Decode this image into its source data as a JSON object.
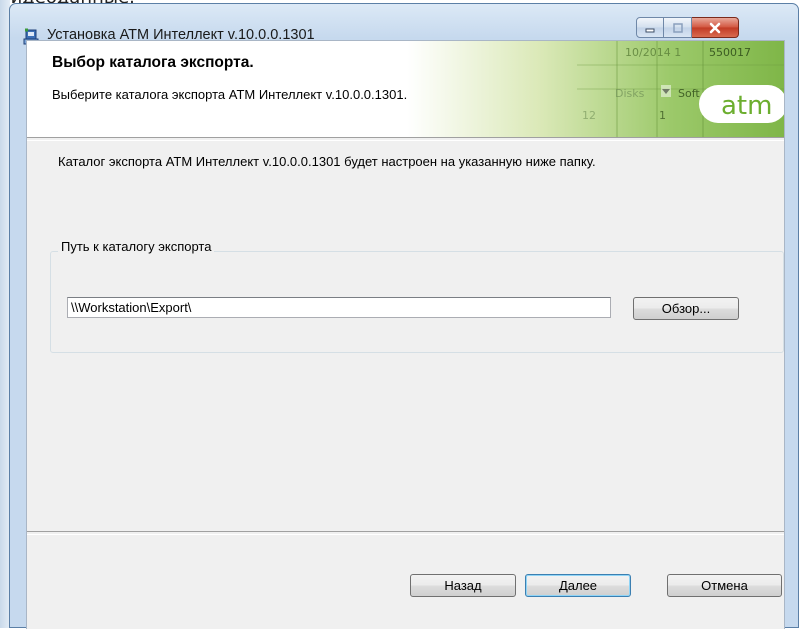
{
  "background_caption": "видеоданные.",
  "window": {
    "title": "Установка ATM Интеллект v.10.0.0.1301",
    "icon": "installer-icon",
    "caption_buttons": [
      "minimize-icon",
      "maximize-icon",
      "close-icon"
    ]
  },
  "banner": {
    "title": "Выбор каталога экспорта.",
    "subtitle": "Выберите каталога экспорта ATM Интеллект v.10.0.0.1301.",
    "logo_text": "atm",
    "decor_texts": [
      "10/2014 1",
      "550017",
      "Disks",
      "Soft",
      "12",
      "1"
    ]
  },
  "description": "Каталог экспорта ATM Интеллект v.10.0.0.1301 будет настроен на указанную ниже папку.",
  "group": {
    "label": "Путь к каталогу экспорта",
    "path_value": "\\\\Workstation\\Export\\",
    "browse_label": "Обзор..."
  },
  "footer": {
    "back_label": "Назад",
    "next_label": "Далее",
    "cancel_label": "Отмена"
  },
  "colors": {
    "logo_green": "#7ab83a",
    "titlebar": "#c6d9ee",
    "dialog_bg": "#f0f0f0",
    "close_button": "#c13b25"
  }
}
